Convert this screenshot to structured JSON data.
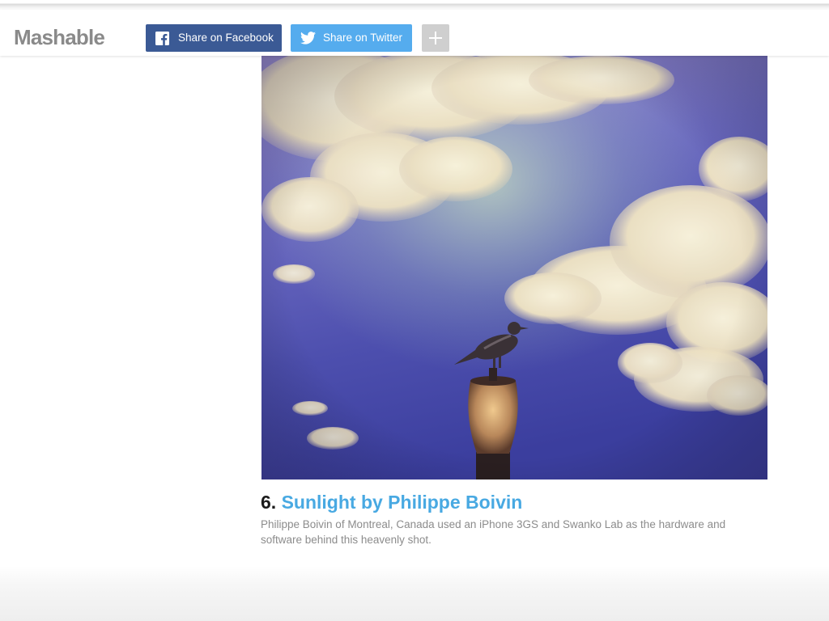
{
  "header": {
    "logo_text": "Mashable",
    "share_facebook_label": "Share on Facebook",
    "share_twitter_label": "Share on Twitter",
    "more_share_icon": "plus-icon"
  },
  "item": {
    "number": "6.",
    "title": "Sunlight by Philippe Boivin",
    "description": "Philippe Boivin of Montreal, Canada used an iPhone 3GS and Swanko Lab as the hardware and software behind this heavenly shot."
  },
  "colors": {
    "facebook": "#3b5a95",
    "twitter": "#55acee",
    "link": "#48a9e2",
    "logo": "#8a8a8a"
  }
}
